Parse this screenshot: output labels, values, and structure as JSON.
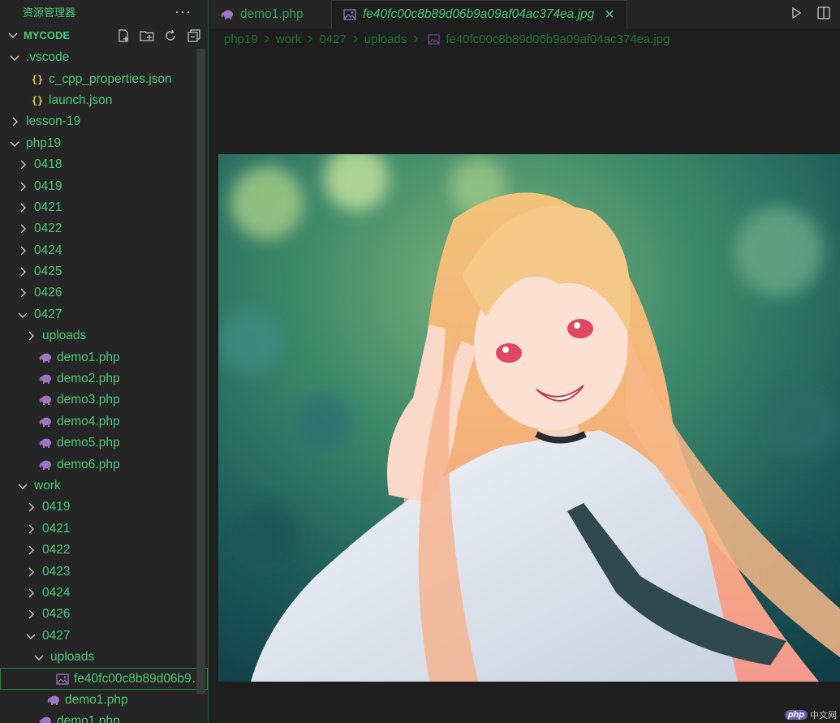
{
  "sidebar": {
    "title": "资源管理器",
    "more": "···",
    "section": "MYCODE",
    "tree": [
      {
        "label": ".vscode",
        "indent": 0,
        "kind": "folder-open"
      },
      {
        "label": "c_cpp_properties.json",
        "indent": 1,
        "kind": "json"
      },
      {
        "label": "launch.json",
        "indent": 1,
        "kind": "json"
      },
      {
        "label": "lesson-19",
        "indent": 0,
        "kind": "folder"
      },
      {
        "label": "php19",
        "indent": 0,
        "kind": "folder-open"
      },
      {
        "label": "0418",
        "indent": 1,
        "kind": "folder"
      },
      {
        "label": "0419",
        "indent": 1,
        "kind": "folder"
      },
      {
        "label": "0421",
        "indent": 1,
        "kind": "folder"
      },
      {
        "label": "0422",
        "indent": 1,
        "kind": "folder"
      },
      {
        "label": "0424",
        "indent": 1,
        "kind": "folder"
      },
      {
        "label": "0425",
        "indent": 1,
        "kind": "folder"
      },
      {
        "label": "0426",
        "indent": 1,
        "kind": "folder"
      },
      {
        "label": "0427",
        "indent": 1,
        "kind": "folder-open"
      },
      {
        "label": "uploads",
        "indent": 2,
        "kind": "folder"
      },
      {
        "label": "demo1.php",
        "indent": 2,
        "kind": "php"
      },
      {
        "label": "demo2.php",
        "indent": 2,
        "kind": "php"
      },
      {
        "label": "demo3.php",
        "indent": 2,
        "kind": "php"
      },
      {
        "label": "demo4.php",
        "indent": 2,
        "kind": "php"
      },
      {
        "label": "demo5.php",
        "indent": 2,
        "kind": "php"
      },
      {
        "label": "demo6.php",
        "indent": 2,
        "kind": "php"
      },
      {
        "label": "work",
        "indent": 1,
        "kind": "folder-open"
      },
      {
        "label": "0419",
        "indent": 2,
        "kind": "folder"
      },
      {
        "label": "0421",
        "indent": 2,
        "kind": "folder"
      },
      {
        "label": "0422",
        "indent": 2,
        "kind": "folder"
      },
      {
        "label": "0423",
        "indent": 2,
        "kind": "folder"
      },
      {
        "label": "0424",
        "indent": 2,
        "kind": "folder"
      },
      {
        "label": "0426",
        "indent": 2,
        "kind": "folder"
      },
      {
        "label": "0427",
        "indent": 2,
        "kind": "folder-open"
      },
      {
        "label": "uploads",
        "indent": 3,
        "kind": "folder-open"
      },
      {
        "label": "fe40fc00c8b89d06b9a...",
        "indent": 4,
        "kind": "image",
        "selected": true
      },
      {
        "label": "demo1.php",
        "indent": 3,
        "kind": "php"
      },
      {
        "label": "demo1.php",
        "indent": 2,
        "kind": "php"
      }
    ]
  },
  "tabs": [
    {
      "label": "demo1.php",
      "icon": "php-elephant-icon"
    },
    {
      "label": "fe40fc00c8b89d06b9a09af04ac374ea.jpg",
      "icon": "image-file-icon",
      "close": "✕"
    }
  ],
  "breadcrumb": [
    "php19",
    "work",
    "0427",
    "uploads",
    "fe40fc00c8b89d06b9a09af04ac374ea.jpg"
  ],
  "watermark": {
    "logo": "php",
    "text": "中文网"
  },
  "colors": {
    "text": "#4ec97a",
    "sidebar_bg": "#252526",
    "editor_bg": "#1e1e1e",
    "php_icon": "#a074c4",
    "json_icon": "#e6c94a"
  }
}
